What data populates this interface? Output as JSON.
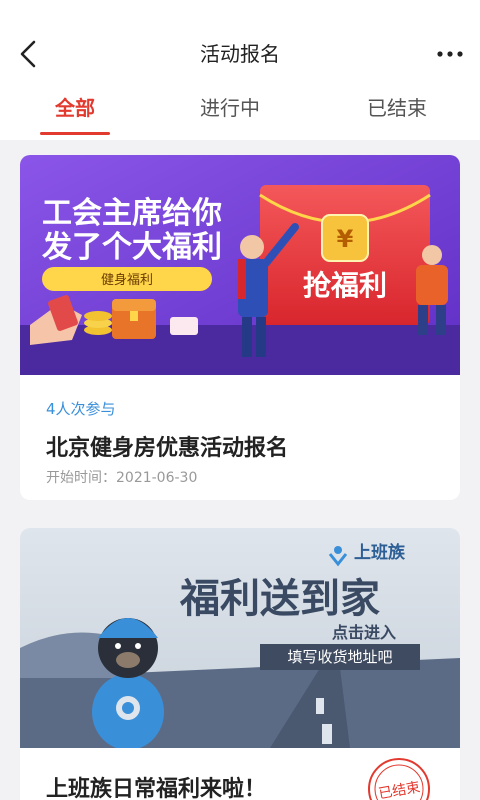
{
  "header": {
    "title": "活动报名"
  },
  "tabs": [
    {
      "label": "全部",
      "active": true
    },
    {
      "label": "进行中",
      "active": false
    },
    {
      "label": "已结束",
      "active": false
    }
  ],
  "cards": [
    {
      "banner": {
        "headline1": "工会主席给你",
        "headline2": "发了个大福利",
        "tag": "健身福利",
        "coin_symbol": "¥",
        "envelope_text": "抢福利"
      },
      "participants": "4人次参与",
      "title": "北京健身房优惠活动报名",
      "start_time": "开始时间：2021-06-30"
    },
    {
      "banner": {
        "brand": "上班族",
        "headline": "福利送到家",
        "sub": "点击进入",
        "strip": "填写收货地址吧"
      },
      "title": "上班族日常福利来啦！",
      "stamp": "已结束"
    }
  ],
  "colors": {
    "accent": "#e23a2f",
    "participants": "#3a8fd9",
    "banner1_bg": "#7a3fd6",
    "banner2_bg": "#5b6b86"
  }
}
